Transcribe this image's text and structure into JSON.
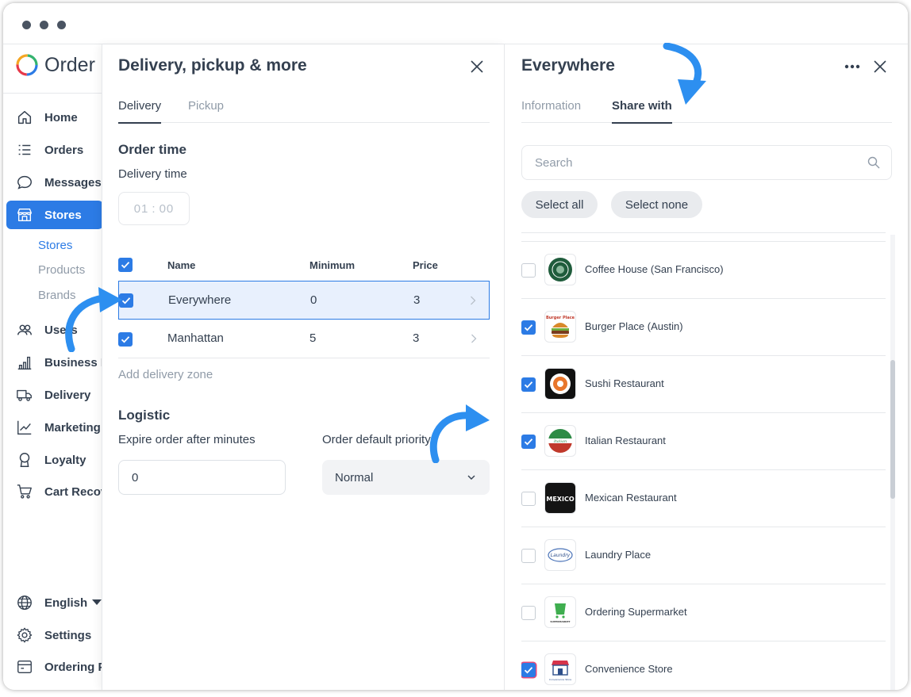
{
  "app": {
    "brand_name": "Order"
  },
  "colors": {
    "accent": "#2c7be5",
    "text": "#344050",
    "muted": "#909ba8",
    "arrow": "#2d8ff0"
  },
  "sidebar": {
    "items": [
      {
        "label": "Home",
        "icon": "home-icon"
      },
      {
        "label": "Orders",
        "icon": "list-icon"
      },
      {
        "label": "Messages",
        "icon": "chat-icon"
      },
      {
        "label": "Stores",
        "icon": "store-icon",
        "active": true
      },
      {
        "label": "Users",
        "icon": "users-icon"
      },
      {
        "label": "Business Intelligence",
        "icon": "bar-chart-icon"
      },
      {
        "label": "Delivery",
        "icon": "truck-icon"
      },
      {
        "label": "Marketing",
        "icon": "line-chart-icon"
      },
      {
        "label": "Loyalty",
        "icon": "award-icon"
      },
      {
        "label": "Cart Recovery",
        "icon": "cart-icon"
      }
    ],
    "sub_items": [
      {
        "label": "Stores",
        "active": true
      },
      {
        "label": "Products"
      },
      {
        "label": "Brands"
      }
    ],
    "bottom_items": [
      {
        "label": "English",
        "icon": "globe-icon"
      },
      {
        "label": "Settings",
        "icon": "gear-icon"
      },
      {
        "label": "Ordering Pro",
        "icon": "window-icon"
      }
    ]
  },
  "delivery_panel": {
    "title": "Delivery, pickup & more",
    "tabs": [
      {
        "label": "Delivery",
        "active": true
      },
      {
        "label": "Pickup"
      }
    ],
    "order_time": {
      "title": "Order time",
      "delivery_time_label": "Delivery time",
      "hours": "01",
      "separator": ":",
      "minutes": "00"
    },
    "table": {
      "headers": {
        "name": "Name",
        "minimum": "Minimum",
        "price": "Price"
      },
      "rows": [
        {
          "name": "Everywhere",
          "minimum": "0",
          "price": "3",
          "checked": true,
          "selected": true
        },
        {
          "name": "Manhattan",
          "minimum": "5",
          "price": "3",
          "checked": true,
          "selected": false
        }
      ]
    },
    "add_zone_label": "Add delivery zone",
    "logistic": {
      "title": "Logistic",
      "expire_label": "Expire order after minutes",
      "expire_value": "0",
      "priority_label": "Order default priority",
      "priority_value": "Normal"
    }
  },
  "share_panel": {
    "title": "Everywhere",
    "tabs": [
      {
        "label": "Information"
      },
      {
        "label": "Share with",
        "active": true
      }
    ],
    "search_placeholder": "Search",
    "select_all_label": "Select all",
    "select_none_label": "Select none",
    "stores": [
      {
        "name": "Coffee House (San Francisco)",
        "checked": false,
        "logo": "coffee-logo"
      },
      {
        "name": "Burger Place (Austin)",
        "checked": true,
        "logo": "burger-logo",
        "logo_text": "Burger Place"
      },
      {
        "name": "Sushi Restaurant",
        "checked": true,
        "logo": "sushi-logo"
      },
      {
        "name": "Italian Restaurant",
        "checked": true,
        "logo": "italian-logo",
        "logo_text": "Italian"
      },
      {
        "name": "Mexican Restaurant",
        "checked": false,
        "logo": "mexican-logo",
        "logo_text": "MEXICO"
      },
      {
        "name": "Laundry Place",
        "checked": false,
        "logo": "laundry-logo",
        "logo_text": "Laundry"
      },
      {
        "name": "Ordering Supermarket",
        "checked": false,
        "logo": "supermarket-logo",
        "logo_text": "SUPERMARKET"
      },
      {
        "name": "Convenience Store",
        "checked": true,
        "logo": "convenience-logo",
        "logo_text": "Convenience Store"
      }
    ]
  }
}
